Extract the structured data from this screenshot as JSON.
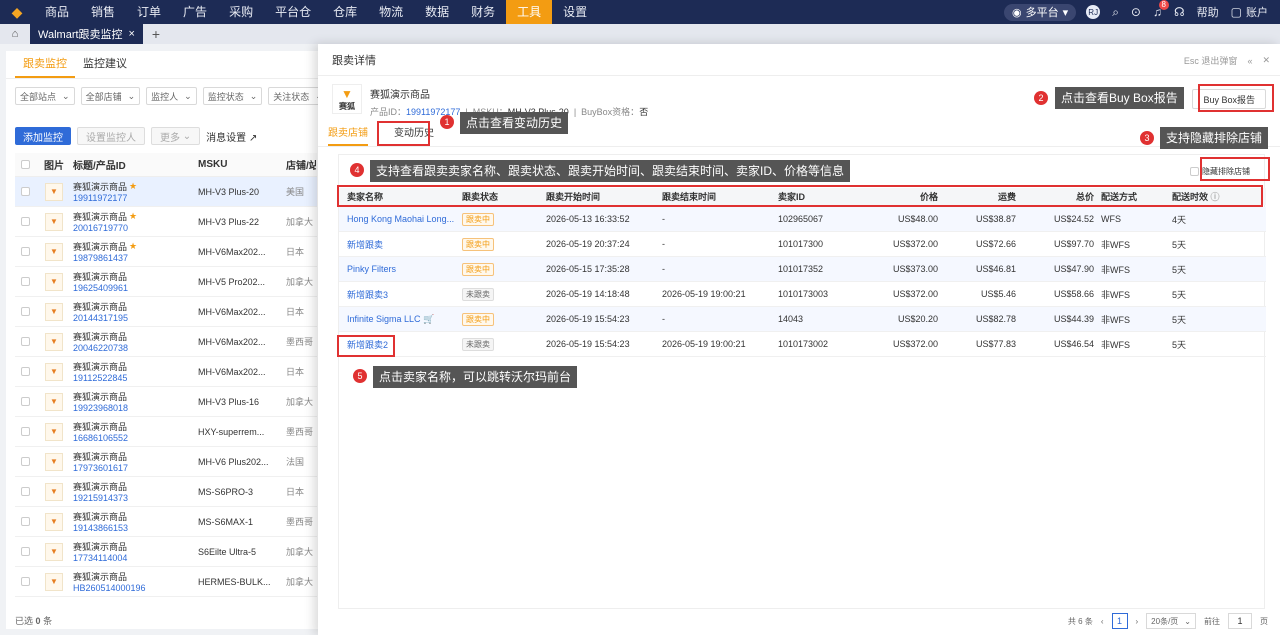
{
  "nav": {
    "items": [
      "商品",
      "销售",
      "订单",
      "广告",
      "采购",
      "平台仓",
      "仓库",
      "物流",
      "数据",
      "财务",
      "工具",
      "设置"
    ],
    "active_index": 10,
    "platform": "多平台",
    "avatar": "RJ",
    "notif_count": "8",
    "help": "帮助",
    "account": "账户"
  },
  "tabs": {
    "page_tab": "Walmart跟卖监控",
    "close_glyph": "×",
    "add_glyph": "+"
  },
  "left": {
    "subtabs": [
      "跟卖监控",
      "监控建议"
    ],
    "filters": [
      "全部站点",
      "全部店铺",
      "监控人",
      "监控状态",
      "关注状态"
    ],
    "add_btn": "添加监控",
    "set_btn": "设置监控人",
    "more_btn": "更多",
    "msg_link": "消息设置",
    "headers": [
      "图片",
      "标题/产品ID",
      "MSKU",
      "店铺/站"
    ],
    "rows": [
      {
        "title": "赛狐演示商品",
        "id": "19911972177",
        "msku": "MH-V3 Plus-20",
        "store": "美国",
        "star": true,
        "sel": true
      },
      {
        "title": "赛狐演示商品",
        "id": "20016719770",
        "msku": "MH-V3 Plus-22",
        "store": "加拿大",
        "star": true,
        "sel": false
      },
      {
        "title": "赛狐演示商品",
        "id": "19879861437",
        "msku": "MH-V6Max202...",
        "store": "日本",
        "star": true,
        "sel": false
      },
      {
        "title": "赛狐演示商品",
        "id": "19625409961",
        "msku": "MH-V5 Pro202...",
        "store": "加拿大",
        "star": false,
        "sel": false
      },
      {
        "title": "赛狐演示商品",
        "id": "20144317195",
        "msku": "MH-V6Max202...",
        "store": "日本",
        "star": false,
        "sel": false
      },
      {
        "title": "赛狐演示商品",
        "id": "20046220738",
        "msku": "MH-V6Max202...",
        "store": "墨西哥",
        "star": false,
        "sel": false
      },
      {
        "title": "赛狐演示商品",
        "id": "19112522845",
        "msku": "MH-V6Max202...",
        "store": "日本",
        "star": false,
        "sel": false
      },
      {
        "title": "赛狐演示商品",
        "id": "19923968018",
        "msku": "MH-V3 Plus-16",
        "store": "加拿大",
        "star": false,
        "sel": false
      },
      {
        "title": "赛狐演示商品",
        "id": "16686106552",
        "msku": "HXY-superrem...",
        "store": "墨西哥",
        "star": false,
        "sel": false
      },
      {
        "title": "赛狐演示商品",
        "id": "17973601617",
        "msku": "MH-V6 Plus202...",
        "store": "法国",
        "star": false,
        "sel": false
      },
      {
        "title": "赛狐演示商品",
        "id": "19215914373",
        "msku": "MS-S6PRO-3",
        "store": "日本",
        "star": false,
        "sel": false
      },
      {
        "title": "赛狐演示商品",
        "id": "19143866153",
        "msku": "MS-S6MAX-1",
        "store": "墨西哥",
        "star": false,
        "sel": false
      },
      {
        "title": "赛狐演示商品",
        "id": "17734114004",
        "msku": "S6Eilte Ultra-5",
        "store": "加拿大",
        "star": false,
        "sel": false
      },
      {
        "title": "赛狐演示商品",
        "id": "HB260514000196",
        "msku": "HERMES-BULK...",
        "store": "加拿大",
        "star": false,
        "sel": false
      }
    ],
    "footer_label": "已选",
    "footer_count": "0",
    "footer_unit": "条"
  },
  "drawer": {
    "title": "跟卖详情",
    "esc": "Esc 退出弹窗",
    "img_label": "赛狐",
    "product_title": "赛狐演示商品",
    "id_label": "产品ID：",
    "id": "19911972177",
    "msku_label": "MSKU：",
    "msku": "MH-V3 Plus-20",
    "buybox_label": "BuyBox资格：",
    "buybox": "否",
    "buybox_btn": "Buy Box报告",
    "tabs": [
      "跟卖店铺",
      "变动历史"
    ],
    "hide_label": "隐藏排除店铺",
    "headers": [
      "卖家名称",
      "跟卖状态",
      "跟卖开始时间",
      "跟卖结束时间",
      "卖家ID",
      "价格",
      "运费",
      "总价",
      "配送方式",
      "配送时效"
    ],
    "rows": [
      {
        "name": "Hong Kong Maohai Long...",
        "status": "跟卖中",
        "on": true,
        "start": "2026-05-13 16:33:52",
        "end": "-",
        "sid": "102965067",
        "price": "US$48.00",
        "ship": "US$38.87",
        "total": "US$24.52",
        "method": "WFS",
        "eta": "4天",
        "cart": false
      },
      {
        "name": "新增跟卖",
        "status": "跟卖中",
        "on": true,
        "start": "2026-05-19 20:37:24",
        "end": "-",
        "sid": "101017300",
        "price": "US$372.00",
        "ship": "US$72.66",
        "total": "US$97.70",
        "method": "非WFS",
        "eta": "5天",
        "cart": false
      },
      {
        "name": "Pinky Filters",
        "status": "跟卖中",
        "on": true,
        "start": "2026-05-15 17:35:28",
        "end": "-",
        "sid": "101017352",
        "price": "US$373.00",
        "ship": "US$46.81",
        "total": "US$47.90",
        "method": "非WFS",
        "eta": "5天",
        "cart": false
      },
      {
        "name": "新增跟卖3",
        "status": "未跟卖",
        "on": false,
        "start": "2026-05-19 14:18:48",
        "end": "2026-05-19 19:00:21",
        "sid": "1010173003",
        "price": "US$372.00",
        "ship": "US$5.46",
        "total": "US$58.66",
        "method": "非WFS",
        "eta": "5天",
        "cart": false
      },
      {
        "name": "Infinite Sigma LLC",
        "status": "跟卖中",
        "on": true,
        "start": "2026-05-19 15:54:23",
        "end": "-",
        "sid": "14043",
        "price": "US$20.20",
        "ship": "US$82.78",
        "total": "US$44.39",
        "method": "非WFS",
        "eta": "5天",
        "cart": true
      },
      {
        "name": "新增跟卖2",
        "status": "未跟卖",
        "on": false,
        "start": "2026-05-19 15:54:23",
        "end": "2026-05-19 19:00:21",
        "sid": "1010173002",
        "price": "US$372.00",
        "ship": "US$77.83",
        "total": "US$46.54",
        "method": "非WFS",
        "eta": "5天",
        "cart": false
      }
    ],
    "pager": {
      "total_prefix": "共",
      "total": "6",
      "total_suffix": "条",
      "page": "1",
      "size": "20条/页",
      "goto_label": "前往",
      "goto_value": "1",
      "page_unit": "页"
    }
  },
  "annotations": [
    {
      "num": "1",
      "text": "点击查看变动历史"
    },
    {
      "num": "2",
      "text": "点击查看Buy Box报告"
    },
    {
      "num": "3",
      "text": "支持隐藏排除店铺"
    },
    {
      "num": "4",
      "text": "支持查看跟卖卖家名称、跟卖状态、跟卖开始时间、跟卖结束时间、卖家ID、价格等信息"
    },
    {
      "num": "5",
      "text": "点击卖家名称，可以跳转沃尔玛前台"
    }
  ],
  "colors": {
    "nav_bg": "#1d2b55",
    "accent": "#f39c12",
    "link": "#2f6bd8",
    "annotation_red": "#e03131"
  }
}
